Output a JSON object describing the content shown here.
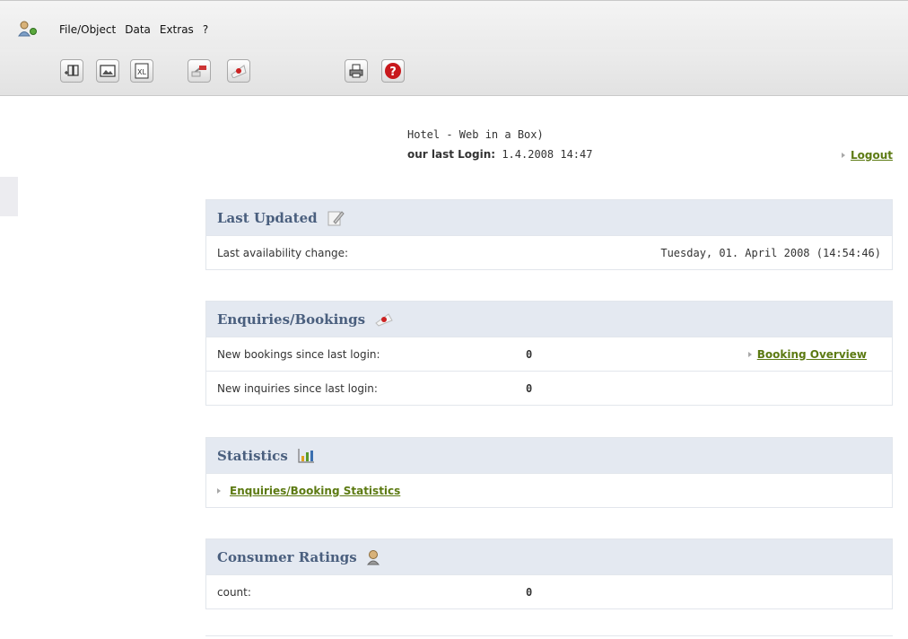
{
  "menubar": {
    "items": [
      "File/Object",
      "Data",
      "Extras",
      "?"
    ]
  },
  "toolbar": {
    "buttons": [
      "add-object-icon",
      "image-icon",
      "excel-export-icon",
      "transfer-icon",
      "stamp-icon",
      "print-icon",
      "help-icon"
    ]
  },
  "header": {
    "hotel_name": "Hotel - Web in a Box)",
    "last_login_label": "our last Login:",
    "last_login_value": " 1.4.2008  14:47",
    "logout_label": "Logout"
  },
  "last_updated": {
    "title": "Last Updated",
    "icon": "edit-icon",
    "label": "Last availability change:",
    "value": "Tuesday, 01. April 2008 (14:54:46)"
  },
  "enquiries": {
    "title": "Enquiries/Bookings",
    "icon": "stamp-icon",
    "rows": [
      {
        "label": "New bookings since last login:",
        "value": "0"
      },
      {
        "label": "New inquiries since last login:",
        "value": "0"
      }
    ],
    "link": "Booking Overview"
  },
  "statistics": {
    "title": "Statistics",
    "icon": "bar-chart-icon",
    "link": "Enquiries/Booking Statistics"
  },
  "ratings": {
    "title": "Consumer Ratings",
    "icon": "person-icon",
    "label": "count:",
    "value": "0"
  },
  "colors": {
    "panel_header_bg": "#e4e9f1",
    "panel_title": "#4a5f7e",
    "link": "#5c7a12"
  }
}
